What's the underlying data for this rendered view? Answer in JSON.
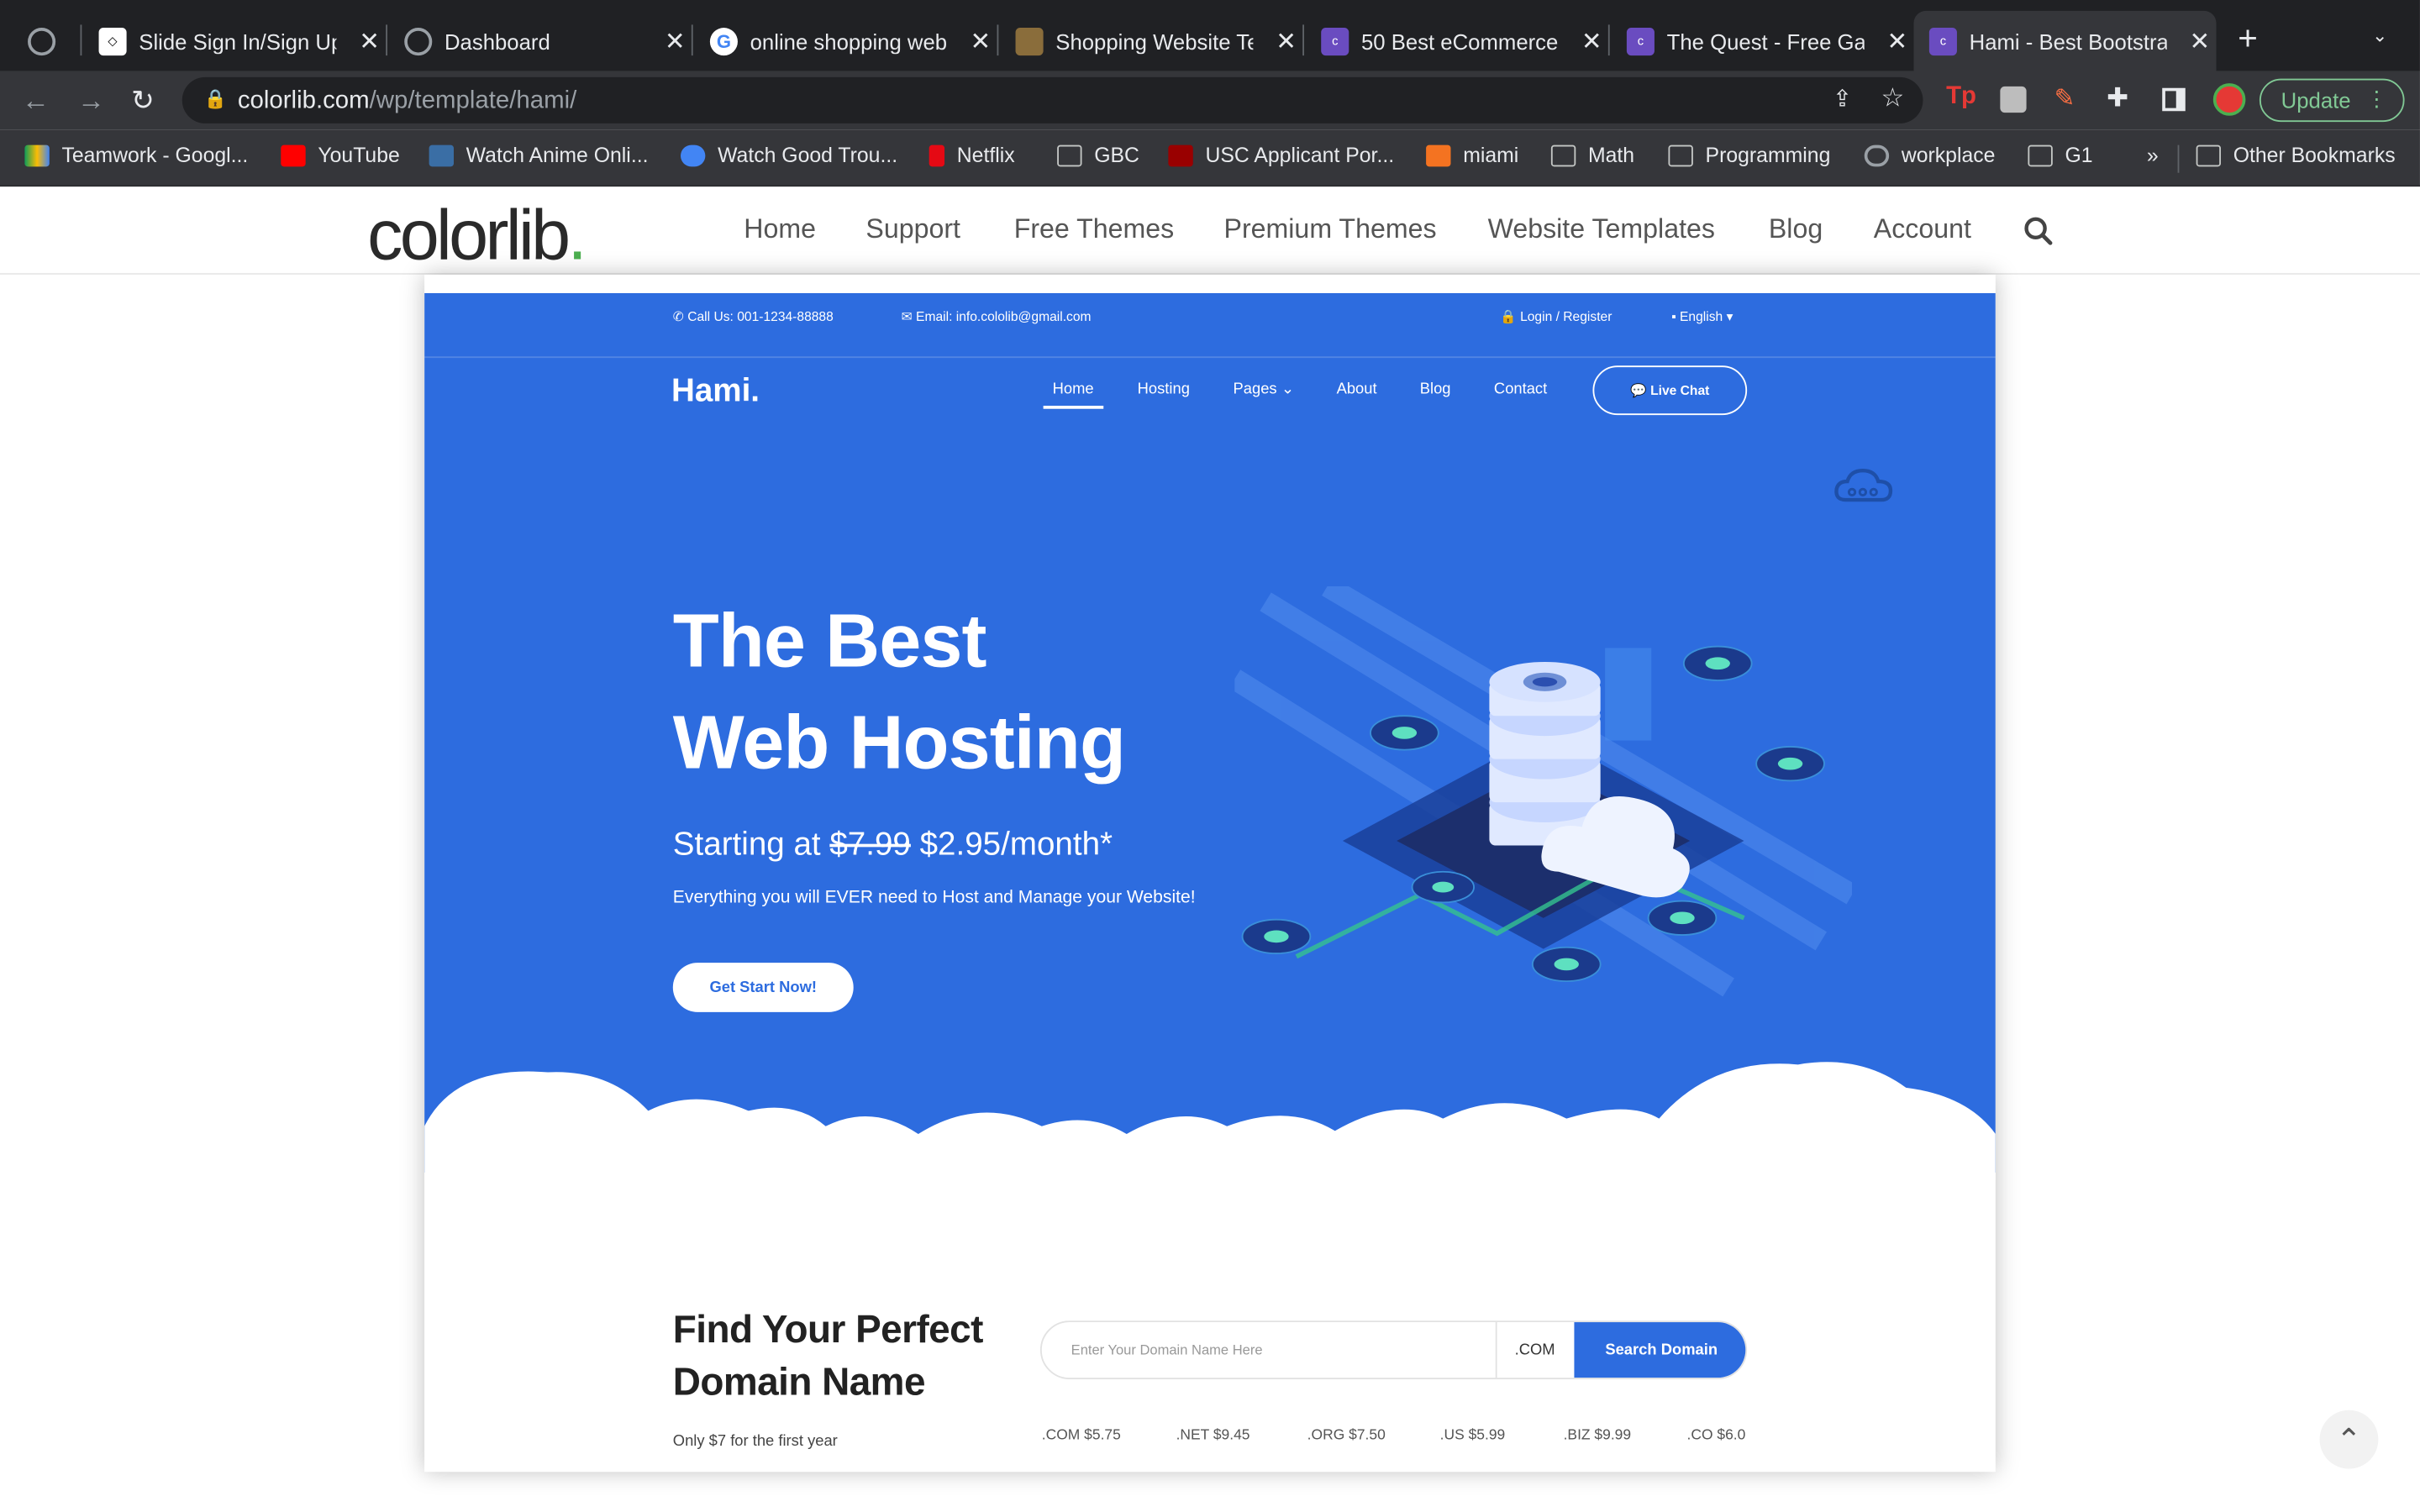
{
  "browser": {
    "tabs": [
      {
        "title": "",
        "icon": "globe-icon"
      },
      {
        "title": "Slide Sign In/Sign Up",
        "icon": "codepen-icon"
      },
      {
        "title": "Dashboard",
        "icon": "globe-icon"
      },
      {
        "title": "online shopping web",
        "icon": "google-icon"
      },
      {
        "title": "Shopping Website Te",
        "icon": "page-icon"
      },
      {
        "title": "50 Best eCommerce",
        "icon": "colorlib-icon"
      },
      {
        "title": "The Quest - Free Ga",
        "icon": "colorlib-icon"
      },
      {
        "title": "Hami - Best Bootstra",
        "icon": "colorlib-icon"
      }
    ],
    "url_domain": "colorlib.com",
    "url_path": "/wp/template/hami/",
    "update_label": "Update",
    "bookmarks": [
      {
        "label": "Teamwork - Googl...",
        "icon": "drive-icon",
        "color": "#fbbc04"
      },
      {
        "label": "YouTube",
        "icon": "youtube-icon",
        "color": "#ff0000"
      },
      {
        "label": "Watch Anime Onli...",
        "icon": "anime-icon",
        "color": "#3a6ea5"
      },
      {
        "label": "Watch Good Trou...",
        "icon": "play-icon",
        "color": "#4285f4"
      },
      {
        "label": "Netflix",
        "icon": "netflix-icon",
        "color": "#e50914"
      },
      {
        "label": "GBC",
        "icon": "folder-icon",
        "color": ""
      },
      {
        "label": "USC Applicant Por...",
        "icon": "usc-icon",
        "color": "#990000"
      },
      {
        "label": "miami",
        "icon": "miami-icon",
        "color": "#f47321"
      },
      {
        "label": "Math",
        "icon": "folder-icon",
        "color": ""
      },
      {
        "label": "Programming",
        "icon": "folder-icon",
        "color": ""
      },
      {
        "label": "workplace",
        "icon": "globe-icon",
        "color": "#9aa0a6"
      },
      {
        "label": "G1",
        "icon": "folder-icon",
        "color": ""
      }
    ],
    "more_bookmarks": "»",
    "other_bookmarks": "Other Bookmarks"
  },
  "site": {
    "logo_text": "colorlib",
    "logo_dot": ".",
    "nav": [
      "Home",
      "Support",
      "Free Themes",
      "Premium Themes",
      "Website Templates",
      "Blog",
      "Account"
    ]
  },
  "preview": {
    "call": "Call Us: 001-1234-88888",
    "email": "Email: info.cololib@gmail.com",
    "login": "Login / Register",
    "language": "English",
    "brand": "Hami.",
    "nav": [
      "Home",
      "Hosting",
      "Pages",
      "About",
      "Blog",
      "Contact"
    ],
    "live_chat": "Live Chat",
    "headline_1": "The Best",
    "headline_2": "Web Hosting",
    "price_prefix": "Starting at ",
    "price_old": "$7.99",
    "price_new": " $2.95/month*",
    "subtitle": "Everything you will EVER need to Host and Manage your Website!",
    "cta": "Get Start Now!",
    "domain_title_1": "Find Your Perfect",
    "domain_title_2": "Domain Name",
    "domain_note": "Only $7 for the first year",
    "domain_placeholder": "Enter Your Domain Name Here",
    "domain_ext": ".COM",
    "domain_button": "Search Domain",
    "tld_prices": [
      ".COM $5.75",
      ".NET $9.45",
      ".ORG $7.50",
      ".US $5.99",
      ".BIZ $9.99",
      ".CO $6.0"
    ]
  },
  "colors": {
    "hero_blue": "#2d6cdf",
    "chrome_dark": "#202124",
    "logo_green": "#4caf50"
  }
}
